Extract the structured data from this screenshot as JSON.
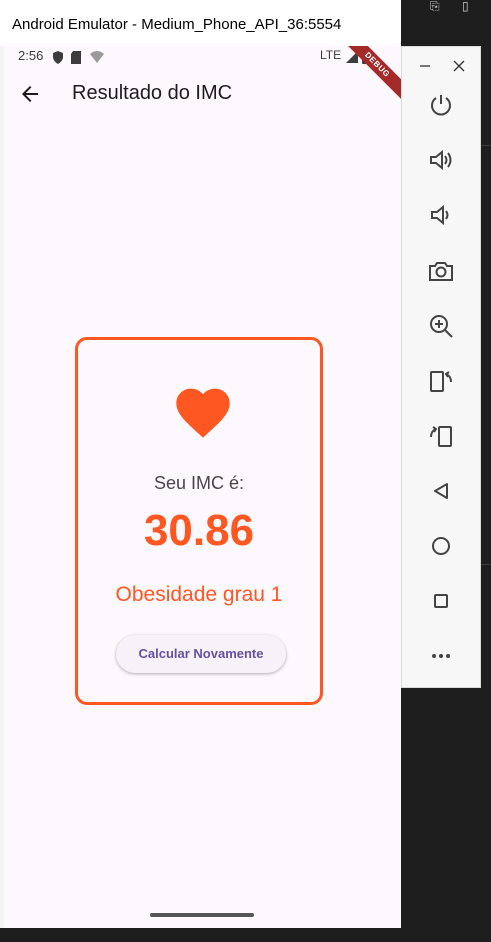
{
  "window": {
    "title": "Android Emulator - Medium_Phone_API_36:5554"
  },
  "statusbar": {
    "time": "2:56",
    "network": "LTE",
    "debug_banner": "DEBUG"
  },
  "appbar": {
    "title": "Resultado do IMC"
  },
  "result": {
    "label": "Seu IMC é:",
    "value": "30.86",
    "category": "Obesidade grau 1",
    "button_label": "Calcular Novamente"
  },
  "colors": {
    "accent": "#ff5722",
    "button_text": "#6750a4",
    "background": "#fdf7fe"
  },
  "toolbar_icons": [
    "power-icon",
    "volume-up-icon",
    "volume-down-icon",
    "camera-icon",
    "zoom-in-icon",
    "rotate-left-icon",
    "rotate-right-icon",
    "back-icon",
    "home-icon",
    "overview-icon",
    "more-icon"
  ]
}
